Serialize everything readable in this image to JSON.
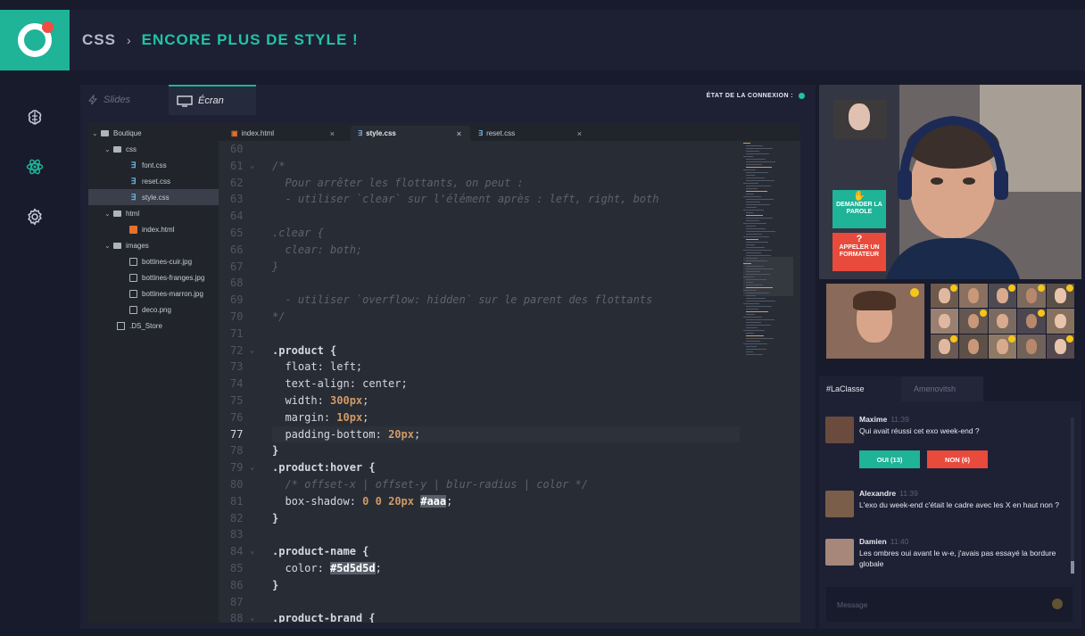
{
  "header": {
    "course": "CSS",
    "separator": "›",
    "chapter": "ENCORE PLUS DE STYLE !"
  },
  "nav": {
    "items": [
      "brain-icon",
      "atom-icon",
      "gear-icon"
    ],
    "accent": "#1fb398"
  },
  "view_tabs": {
    "slides_label": "Slides",
    "screen_label": "Écran"
  },
  "connection": {
    "label": "ÉTAT DE LA CONNEXION :",
    "status_color": "#1fc4a6"
  },
  "file_tree": [
    {
      "label": "Boutique",
      "type": "folder",
      "depth": 0,
      "open": true
    },
    {
      "label": "css",
      "type": "folder",
      "depth": 1,
      "open": true
    },
    {
      "label": "font.css",
      "type": "css",
      "depth": 2
    },
    {
      "label": "reset.css",
      "type": "css",
      "depth": 2
    },
    {
      "label": "style.css",
      "type": "css",
      "depth": 2,
      "selected": true
    },
    {
      "label": "html",
      "type": "folder",
      "depth": 1,
      "open": true
    },
    {
      "label": "index.html",
      "type": "html",
      "depth": 2
    },
    {
      "label": "images",
      "type": "folder",
      "depth": 1,
      "open": true
    },
    {
      "label": "bottines-cuir.jpg",
      "type": "image",
      "depth": 2
    },
    {
      "label": "bottines-franges.jpg",
      "type": "image",
      "depth": 2
    },
    {
      "label": "bottines-marron.jpg",
      "type": "image",
      "depth": 2
    },
    {
      "label": "deco.png",
      "type": "image",
      "depth": 2
    },
    {
      "label": ".DS_Store",
      "type": "file",
      "depth": 1
    }
  ],
  "file_tabs": [
    {
      "label": "index.html",
      "type": "html"
    },
    {
      "label": "style.css",
      "type": "css",
      "active": true
    },
    {
      "label": "reset.css",
      "type": "css"
    }
  ],
  "editor": {
    "current_line": "77",
    "lines": [
      {
        "n": "60",
        "code": ""
      },
      {
        "n": "61",
        "code": "/*",
        "fold": true
      },
      {
        "n": "62",
        "code": "  Pour arrêter les flottants, on peut :"
      },
      {
        "n": "63",
        "code": "  - utiliser `clear` sur l'élément après : left, right, both"
      },
      {
        "n": "64",
        "code": ""
      },
      {
        "n": "65",
        "code": ".clear {"
      },
      {
        "n": "66",
        "code": "  clear: both;"
      },
      {
        "n": "67",
        "code": "}"
      },
      {
        "n": "68",
        "code": ""
      },
      {
        "n": "69",
        "code": "  - utiliser `overflow: hidden` sur le parent des flottants"
      },
      {
        "n": "70",
        "code": "*/"
      },
      {
        "n": "71",
        "code": ""
      },
      {
        "n": "72",
        "code": ".product {",
        "fold": true
      },
      {
        "n": "73",
        "code": "  float: left;"
      },
      {
        "n": "74",
        "code": "  text-align: center;"
      },
      {
        "n": "75",
        "code": "  width: 300px;"
      },
      {
        "n": "76",
        "code": "  margin: 10px;"
      },
      {
        "n": "77",
        "code": "  padding-bottom: 20px;"
      },
      {
        "n": "78",
        "code": "}"
      },
      {
        "n": "79",
        "code": ".product:hover {",
        "fold": true
      },
      {
        "n": "80",
        "code": "  /* offset-x | offset-y | blur-radius | color */"
      },
      {
        "n": "81",
        "code": "  box-shadow: 0 0 20px #aaa;"
      },
      {
        "n": "82",
        "code": "}"
      },
      {
        "n": "83",
        "code": ""
      },
      {
        "n": "84",
        "code": ".product-name {",
        "fold": true
      },
      {
        "n": "85",
        "code": "  color: #5d5d5d;"
      },
      {
        "n": "86",
        "code": "}"
      },
      {
        "n": "87",
        "code": ""
      },
      {
        "n": "88",
        "code": ".product-brand {",
        "fold": true
      }
    ]
  },
  "video": {
    "raise_hand": "DEMANDER LA PAROLE",
    "call_trainer": "APPELER UN FORMATEUR",
    "raise_color": "#1fb398",
    "call_color": "#e84a3c"
  },
  "chat": {
    "tabs": [
      "#LaClasse",
      "Amenovitsh"
    ],
    "messages": [
      {
        "author": "Maxime",
        "time": "11:39",
        "text": "Qui avait réussi cet exo week-end ?"
      },
      {
        "author": "Alexandre",
        "time": "11:39",
        "text": "L'exo du week-end c'était le cadre avec les X en haut non ?"
      },
      {
        "author": "Damien",
        "time": "11:40",
        "text": "Les ombres oui avant le w-e, j'avais pas essayé la bordure globale"
      }
    ],
    "poll": {
      "yes": "OUI (13)",
      "no": "NON (6)"
    },
    "input_placeholder": "Message"
  }
}
